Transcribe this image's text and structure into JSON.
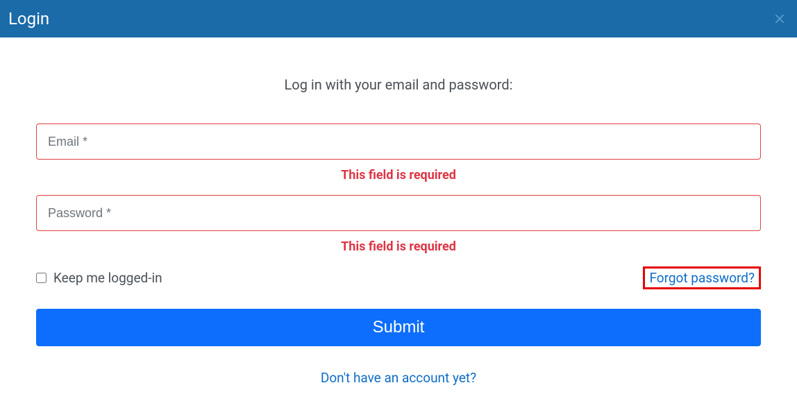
{
  "header": {
    "title": "Login"
  },
  "form": {
    "instruction": "Log in with your email and password:",
    "email": {
      "placeholder": "Email *",
      "error": "This field is required"
    },
    "password": {
      "placeholder": "Password *",
      "error": "This field is required"
    },
    "keep_logged_in_label": "Keep me logged-in",
    "forgot_password_label": "Forgot password?",
    "submit_label": "Submit",
    "signup_label": "Don't have an account yet?"
  }
}
